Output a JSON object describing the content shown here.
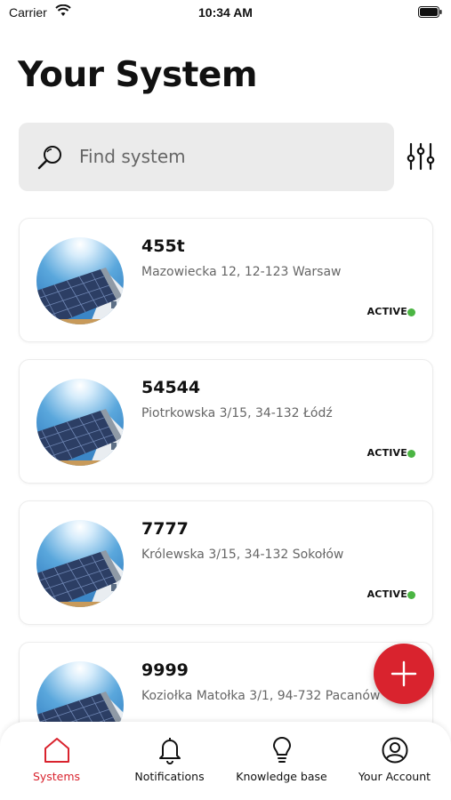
{
  "status_bar": {
    "carrier": "Carrier",
    "time": "10:34 AM"
  },
  "header": {
    "title": "Your System"
  },
  "search": {
    "placeholder": "Find system",
    "value": ""
  },
  "systems": [
    {
      "name": "455t",
      "address": "Mazowiecka 12, 12-123 Warsaw",
      "status": "ACTIVE"
    },
    {
      "name": "54544",
      "address": "Piotrkowska 3/15, 34-132 Łódź",
      "status": "ACTIVE"
    },
    {
      "name": "7777",
      "address": "Królewska 3/15, 34-132 Sokołów",
      "status": "ACTIVE"
    },
    {
      "name": "9999",
      "address": "Koziołka Matołka 3/1, 94-732 Pacanów",
      "status": ""
    }
  ],
  "nav": {
    "items": [
      {
        "label": "Systems",
        "icon": "home-icon",
        "active": true
      },
      {
        "label": "Notifications",
        "icon": "bell-icon",
        "active": false
      },
      {
        "label": "Knowledge base",
        "icon": "lightbulb-icon",
        "active": false
      },
      {
        "label": "Your Account",
        "icon": "user-circle-icon",
        "active": false
      }
    ]
  },
  "colors": {
    "accent": "#d9232e",
    "status_active": "#4bb543",
    "search_bg": "#ebebeb"
  }
}
